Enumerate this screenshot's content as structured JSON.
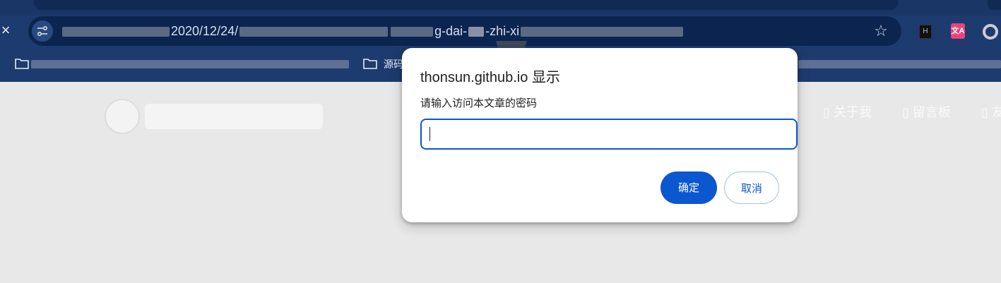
{
  "browser": {
    "close_icon": "×",
    "url_text": "2020/12/24/",
    "url_text_2": "g-dai-",
    "url_text_3": "-zhi-xi",
    "bookmark_visible_label": "源码",
    "star_icon": "☆",
    "extension_1_label": "H",
    "extension_2_label": "文A"
  },
  "page": {
    "nav_items": [
      "关于我",
      "留言板",
      "友"
    ]
  },
  "dialog": {
    "title": "thonsun.github.io 显示",
    "message": "请输入访问本文章的密码",
    "input_value": "",
    "ok_label": "确定",
    "cancel_label": "取消"
  },
  "colors": {
    "chrome_bg": "#1d3b6e",
    "omnibox_bg": "#0c2550",
    "page_bg": "#e8e8e8",
    "accent": "#0b57d0"
  }
}
